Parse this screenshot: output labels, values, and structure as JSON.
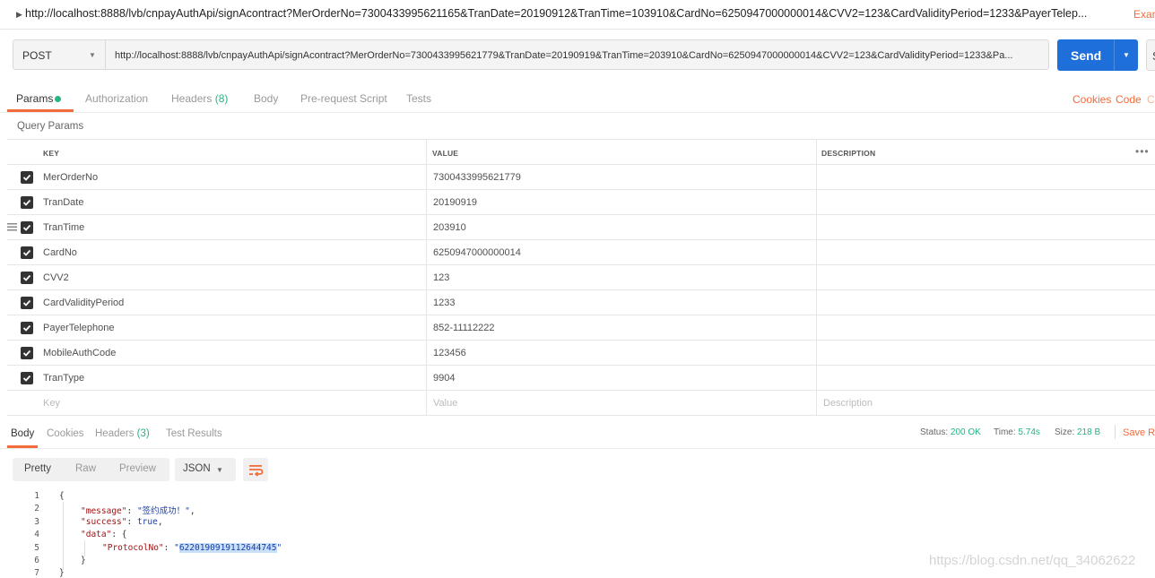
{
  "request": {
    "title_url": "http://localhost:8888/lvb/cnpayAuthApi/signAcontract?MerOrderNo=7300433995621165&TranDate=20190912&TranTime=103910&CardNo=6250947000000014&CVV2=123&CardValidityPeriod=1233&PayerTelep...",
    "examples_label": "Exan",
    "method": "POST",
    "url": "http://localhost:8888/lvb/cnpayAuthApi/signAcontract?MerOrderNo=7300433995621779&TranDate=20190919&TranTime=203910&CardNo=6250947000000014&CVV2=123&CardValidityPeriod=1233&Pa...",
    "send_label": "Send",
    "save_label": "S"
  },
  "tabs": [
    {
      "label": "Params",
      "active": true
    },
    {
      "label": "Authorization"
    },
    {
      "label": "Headers",
      "count": "(8)"
    },
    {
      "label": "Body"
    },
    {
      "label": "Pre-request Script"
    },
    {
      "label": "Tests"
    }
  ],
  "links": {
    "cookies": "Cookies",
    "code": "Code",
    "comments": "C"
  },
  "query_params": {
    "title": "Query Params",
    "headers": {
      "key": "KEY",
      "value": "VALUE",
      "description": "DESCRIPTION"
    },
    "rows": [
      {
        "key": "MerOrderNo",
        "value": "7300433995621779",
        "checked": true
      },
      {
        "key": "TranDate",
        "value": "20190919",
        "checked": true
      },
      {
        "key": "TranTime",
        "value": "203910",
        "checked": true
      },
      {
        "key": "CardNo",
        "value": "6250947000000014",
        "checked": true
      },
      {
        "key": "CVV2",
        "value": "123",
        "checked": true
      },
      {
        "key": "CardValidityPeriod",
        "value": "1233",
        "checked": true
      },
      {
        "key": "PayerTelephone",
        "value": "852-11112222",
        "checked": true
      },
      {
        "key": "MobileAuthCode",
        "value": "123456",
        "checked": true
      },
      {
        "key": "TranType",
        "value": "9904",
        "checked": true
      }
    ],
    "placeholders": {
      "key": "Key",
      "value": "Value",
      "description": "Description"
    }
  },
  "response": {
    "tabs": [
      {
        "label": "Body",
        "active": true
      },
      {
        "label": "Cookies"
      },
      {
        "label": "Headers",
        "count": "(3)"
      },
      {
        "label": "Test Results"
      }
    ],
    "status_label": "Status:",
    "status_value": "200 OK",
    "time_label": "Time:",
    "time_value": "5.74s",
    "size_label": "Size:",
    "size_value": "218 B",
    "save_label": "Save Re",
    "view_modes": [
      "Pretty",
      "Raw",
      "Preview"
    ],
    "active_view": "Pretty",
    "format": "JSON",
    "line_numbers": [
      "1",
      "2",
      "3",
      "4",
      "5",
      "6",
      "7"
    ],
    "code": {
      "open_brace": "{",
      "message_key": "\"message\"",
      "message_value": "\"签约成功！\"",
      "success_key": "\"success\"",
      "success_value": "true",
      "data_key": "\"data\"",
      "data_open": "{",
      "protocol_key": "\"ProtocolNo\"",
      "protocol_value": "62201909191126447​45",
      "data_close": "}",
      "close_brace": "}"
    }
  },
  "watermark": "https://blog.csdn.net/qq_34062622"
}
